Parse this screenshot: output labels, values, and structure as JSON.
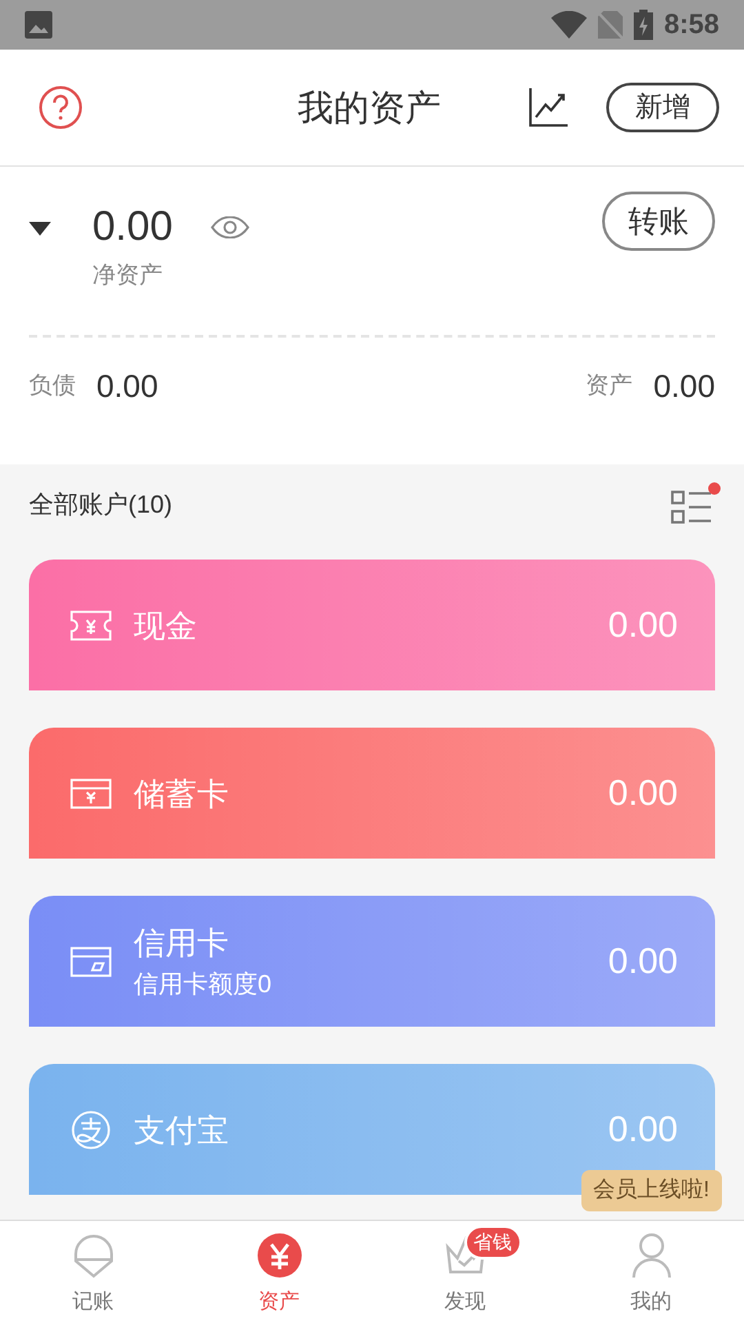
{
  "status_bar": {
    "time": "8:58"
  },
  "header": {
    "title": "我的资产",
    "add_button": "新增"
  },
  "summary": {
    "expanded": true,
    "net_value": "0.00",
    "net_label": "净资产",
    "transfer_button": "转账",
    "liabilities_label": "负债",
    "liabilities_value": "0.00",
    "assets_label": "资产",
    "assets_value": "0.00"
  },
  "accounts_header": {
    "title": "全部账户(10)",
    "has_notice": true
  },
  "accounts": [
    {
      "kind": "cash",
      "name": "现金",
      "value": "0.00",
      "color": "#fb6fa6"
    },
    {
      "kind": "debit",
      "name": "储蓄卡",
      "value": "0.00",
      "color": "#fb6b6b"
    },
    {
      "kind": "credit",
      "name": "信用卡",
      "subtitle": "信用卡额度0",
      "value": "0.00",
      "color": "#7a8ef6"
    },
    {
      "kind": "alipay",
      "name": "支付宝",
      "value": "0.00",
      "color": "#7ab3ee"
    }
  ],
  "tooltip": "会员上线啦!",
  "nav": [
    {
      "kind": "book",
      "label": "记账",
      "selected": false
    },
    {
      "kind": "assets",
      "label": "资产",
      "selected": true
    },
    {
      "kind": "discover",
      "label": "发现",
      "selected": false,
      "badge": "省钱"
    },
    {
      "kind": "me",
      "label": "我的",
      "selected": false
    }
  ]
}
